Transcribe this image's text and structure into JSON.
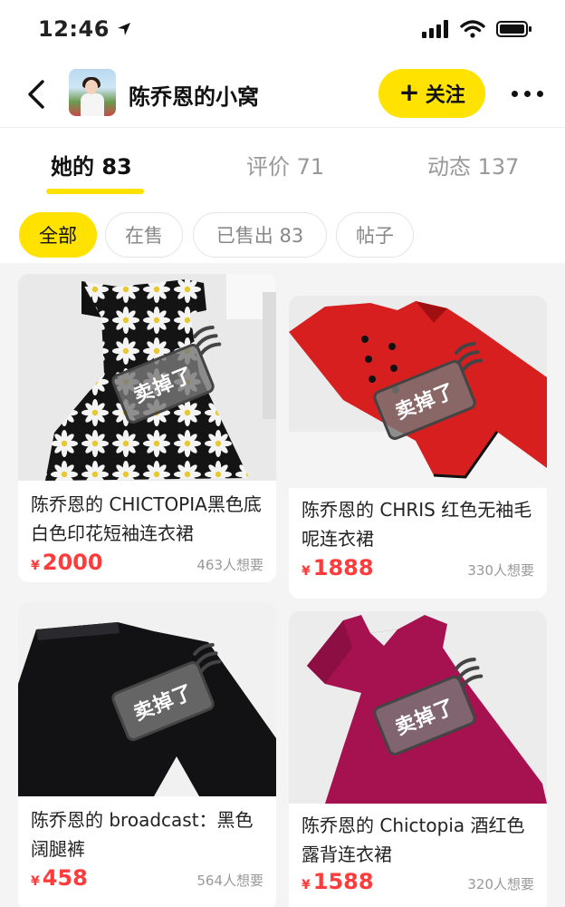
{
  "status_bar": {
    "time": "12:46"
  },
  "header": {
    "shop_name": "陈乔恩的小窝",
    "follow_label": "关注",
    "follow_plus": "+"
  },
  "tabs": [
    {
      "label": "她的 83",
      "active": true
    },
    {
      "label": "评价 71",
      "active": false
    },
    {
      "label": "动态 137",
      "active": false
    }
  ],
  "filters": [
    {
      "label": "全部",
      "active": true
    },
    {
      "label": "在售",
      "active": false
    },
    {
      "label": "已售出 83",
      "active": false
    },
    {
      "label": "帖子",
      "active": false
    }
  ],
  "items": [
    {
      "title": "陈乔恩的 CHICTOPIA黑色底白色印花短袖连衣裙",
      "currency": "¥",
      "price": "2000",
      "wants": "463人想要",
      "stamp": "卖掉了"
    },
    {
      "title": "陈乔恩的 CHRIS 红色无袖毛呢连衣裙",
      "currency": "¥",
      "price": "1888",
      "wants": "330人想要",
      "stamp": "卖掉了"
    },
    {
      "title": "陈乔恩的 broadcast：黑色阔腿裤",
      "currency": "¥",
      "price": "458",
      "wants": "564人想要",
      "stamp": "卖掉了"
    },
    {
      "title": "陈乔恩的 Chictopia 酒红色露背连衣裙",
      "currency": "¥",
      "price": "1588",
      "wants": "320人想要",
      "stamp": "卖掉了"
    }
  ],
  "colors": {
    "accent": "#ffe200",
    "price": "#ff3b3b",
    "muted": "#999999"
  }
}
